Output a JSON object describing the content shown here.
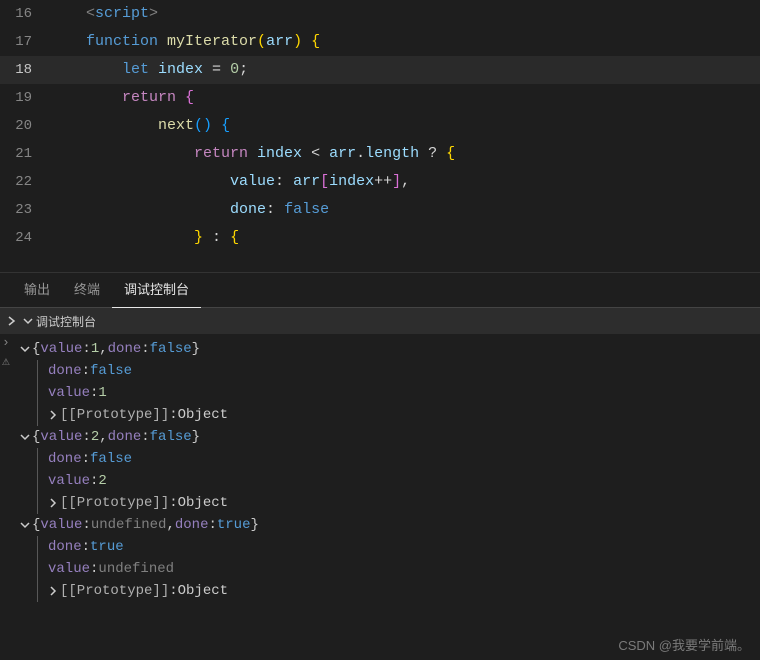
{
  "editor": {
    "lines": [
      {
        "num": "16",
        "tokens": [
          [
            "tag",
            "<"
          ],
          [
            "kw-blue",
            "script"
          ],
          [
            "tag",
            ">"
          ]
        ],
        "indent": 0
      },
      {
        "num": "17",
        "tokens": [
          [
            "kw-blue",
            "function "
          ],
          [
            "fn",
            "myIterator"
          ],
          [
            "brace-y",
            "("
          ],
          [
            "var",
            "arr"
          ],
          [
            "brace-y",
            ")"
          ],
          [
            "punct",
            " "
          ],
          [
            "brace-y",
            "{"
          ]
        ],
        "indent": 0
      },
      {
        "num": "18",
        "tokens": [
          [
            "kw-blue",
            "let "
          ],
          [
            "var",
            "index"
          ],
          [
            "punct",
            " = "
          ],
          [
            "num",
            "0"
          ],
          [
            "punct",
            ";"
          ]
        ],
        "indent": 1,
        "current": true
      },
      {
        "num": "19",
        "tokens": [
          [
            "kw-purple",
            "return "
          ],
          [
            "brace-p",
            "{"
          ]
        ],
        "indent": 1
      },
      {
        "num": "20",
        "tokens": [
          [
            "fn",
            "next"
          ],
          [
            "brace-b",
            "()"
          ],
          [
            "punct",
            " "
          ],
          [
            "brace-b",
            "{"
          ]
        ],
        "indent": 2
      },
      {
        "num": "21",
        "tokens": [
          [
            "kw-purple",
            "return "
          ],
          [
            "var",
            "index"
          ],
          [
            "punct",
            " < "
          ],
          [
            "var",
            "arr"
          ],
          [
            "punct",
            "."
          ],
          [
            "var",
            "length"
          ],
          [
            "punct",
            " ? "
          ],
          [
            "brace-y",
            "{"
          ]
        ],
        "indent": 3
      },
      {
        "num": "22",
        "tokens": [
          [
            "var",
            "value"
          ],
          [
            "punct",
            ": "
          ],
          [
            "var",
            "arr"
          ],
          [
            "brace-p",
            "["
          ],
          [
            "var",
            "index"
          ],
          [
            "punct",
            "++"
          ],
          [
            "brace-p",
            "]"
          ],
          [
            "punct",
            ","
          ]
        ],
        "indent": 4
      },
      {
        "num": "23",
        "tokens": [
          [
            "var",
            "done"
          ],
          [
            "punct",
            ": "
          ],
          [
            "kw-blue",
            "false"
          ]
        ],
        "indent": 4
      },
      {
        "num": "24",
        "tokens": [
          [
            "brace-y",
            "}"
          ],
          [
            "punct",
            " : "
          ],
          [
            "brace-y",
            "{"
          ]
        ],
        "indent": 3
      }
    ]
  },
  "tabs": {
    "output": "输出",
    "terminal": "终端",
    "debug": "调试控制台"
  },
  "debugHeader": "调试控制台",
  "console": {
    "entries": [
      {
        "summary": [
          [
            "obj-punct",
            "{"
          ],
          [
            "obj-key",
            "value"
          ],
          [
            "obj-colon",
            ": "
          ],
          [
            "obj-num",
            "1"
          ],
          [
            "obj-punct",
            ", "
          ],
          [
            "obj-key",
            "done"
          ],
          [
            "obj-colon",
            ": "
          ],
          [
            "obj-bool",
            "false"
          ],
          [
            "obj-punct",
            "}"
          ]
        ],
        "props": [
          [
            [
              "obj-key",
              "done"
            ],
            [
              "obj-colon",
              ": "
            ],
            [
              "obj-bool",
              "false"
            ]
          ],
          [
            [
              "obj-key",
              "value"
            ],
            [
              "obj-colon",
              ": "
            ],
            [
              "obj-num",
              "1"
            ]
          ]
        ],
        "proto": "[[Prototype]]",
        "protoVal": "Object"
      },
      {
        "summary": [
          [
            "obj-punct",
            "{"
          ],
          [
            "obj-key",
            "value"
          ],
          [
            "obj-colon",
            ": "
          ],
          [
            "obj-num",
            "2"
          ],
          [
            "obj-punct",
            ", "
          ],
          [
            "obj-key",
            "done"
          ],
          [
            "obj-colon",
            ": "
          ],
          [
            "obj-bool",
            "false"
          ],
          [
            "obj-punct",
            "}"
          ]
        ],
        "props": [
          [
            [
              "obj-key",
              "done"
            ],
            [
              "obj-colon",
              ": "
            ],
            [
              "obj-bool",
              "false"
            ]
          ],
          [
            [
              "obj-key",
              "value"
            ],
            [
              "obj-colon",
              ": "
            ],
            [
              "obj-num",
              "2"
            ]
          ]
        ],
        "proto": "[[Prototype]]",
        "protoVal": "Object"
      },
      {
        "summary": [
          [
            "obj-punct",
            "{"
          ],
          [
            "obj-key",
            "value"
          ],
          [
            "obj-colon",
            ": "
          ],
          [
            "obj-undef",
            "undefined"
          ],
          [
            "obj-punct",
            ", "
          ],
          [
            "obj-key",
            "done"
          ],
          [
            "obj-colon",
            ": "
          ],
          [
            "obj-bool",
            "true"
          ],
          [
            "obj-punct",
            "}"
          ]
        ],
        "props": [
          [
            [
              "obj-key",
              "done"
            ],
            [
              "obj-colon",
              ": "
            ],
            [
              "obj-bool",
              "true"
            ]
          ],
          [
            [
              "obj-key",
              "value"
            ],
            [
              "obj-colon",
              ": "
            ],
            [
              "obj-undef",
              "undefined"
            ]
          ]
        ],
        "proto": "[[Prototype]]",
        "protoVal": "Object"
      }
    ]
  },
  "watermark": "CSDN @我要学前端。"
}
